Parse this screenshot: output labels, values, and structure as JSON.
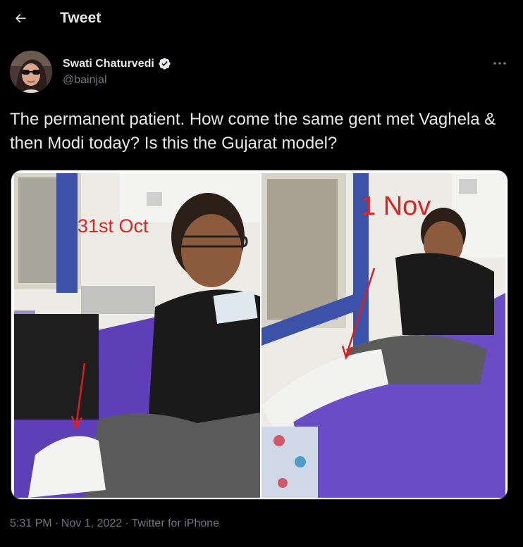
{
  "header": {
    "title": "Tweet"
  },
  "author": {
    "display_name": "Swati Chaturvedi",
    "handle": "@bainjal"
  },
  "tweet": {
    "text": "The permanent patient. How come the same gent met Vaghela & then Modi today? Is this the Gujarat model?",
    "media": {
      "left_label": "31st Oct",
      "right_label": "1 Nov"
    },
    "time": "5:31 PM",
    "date": "Nov 1, 2022",
    "source": "Twitter for iPhone",
    "separator": "·"
  },
  "colors": {
    "background": "#000000",
    "text_primary": "#e7e9ea",
    "text_secondary": "#71767b",
    "label_red": "#e5201e"
  },
  "icons": {
    "back": "arrow-left-icon",
    "verified": "verified-badge-icon",
    "more": "more-dots-icon"
  }
}
